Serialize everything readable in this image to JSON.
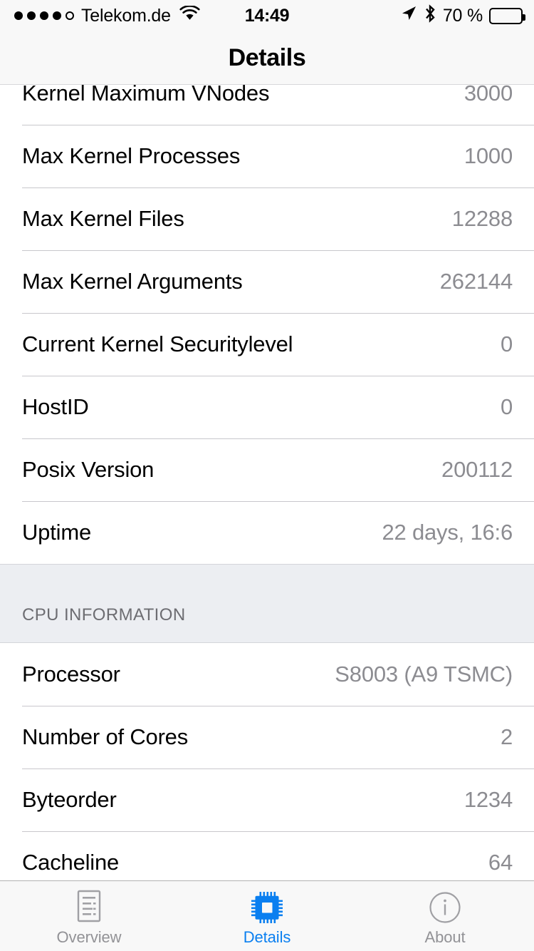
{
  "status_bar": {
    "carrier": "Telekom.de",
    "signal_bars_filled": 4,
    "signal_bars_total": 5,
    "wifi_icon": "wifi-icon",
    "time": "14:49",
    "location_icon": "location-arrow-icon",
    "bluetooth_icon": "bluetooth-icon",
    "battery_percent_label": "70 %",
    "battery_level": 70
  },
  "nav_bar": {
    "title": "Details"
  },
  "sections": [
    {
      "header": null,
      "rows": [
        {
          "label": "Kernel Maximum VNodes",
          "value": "3000"
        },
        {
          "label": "Max Kernel Processes",
          "value": "1000"
        },
        {
          "label": "Max Kernel Files",
          "value": "12288"
        },
        {
          "label": "Max Kernel Arguments",
          "value": "262144"
        },
        {
          "label": "Current Kernel Securitylevel",
          "value": "0"
        },
        {
          "label": "HostID",
          "value": "0"
        },
        {
          "label": "Posix Version",
          "value": "200112"
        },
        {
          "label": "Uptime",
          "value": "22 days, 16:6"
        }
      ]
    },
    {
      "header": "CPU INFORMATION",
      "rows": [
        {
          "label": "Processor",
          "value": "S8003 (A9 TSMC)"
        },
        {
          "label": "Number of Cores",
          "value": "2"
        },
        {
          "label": "Byteorder",
          "value": "1234"
        },
        {
          "label": "Cacheline",
          "value": "64"
        }
      ]
    }
  ],
  "tab_bar": {
    "active_index": 1,
    "items": [
      {
        "label": "Overview",
        "icon": "document-report-icon"
      },
      {
        "label": "Details",
        "icon": "cpu-chip-icon"
      },
      {
        "label": "About",
        "icon": "info-circle-icon"
      }
    ],
    "active_color": "#0a7ff0",
    "inactive_color": "#929296"
  }
}
